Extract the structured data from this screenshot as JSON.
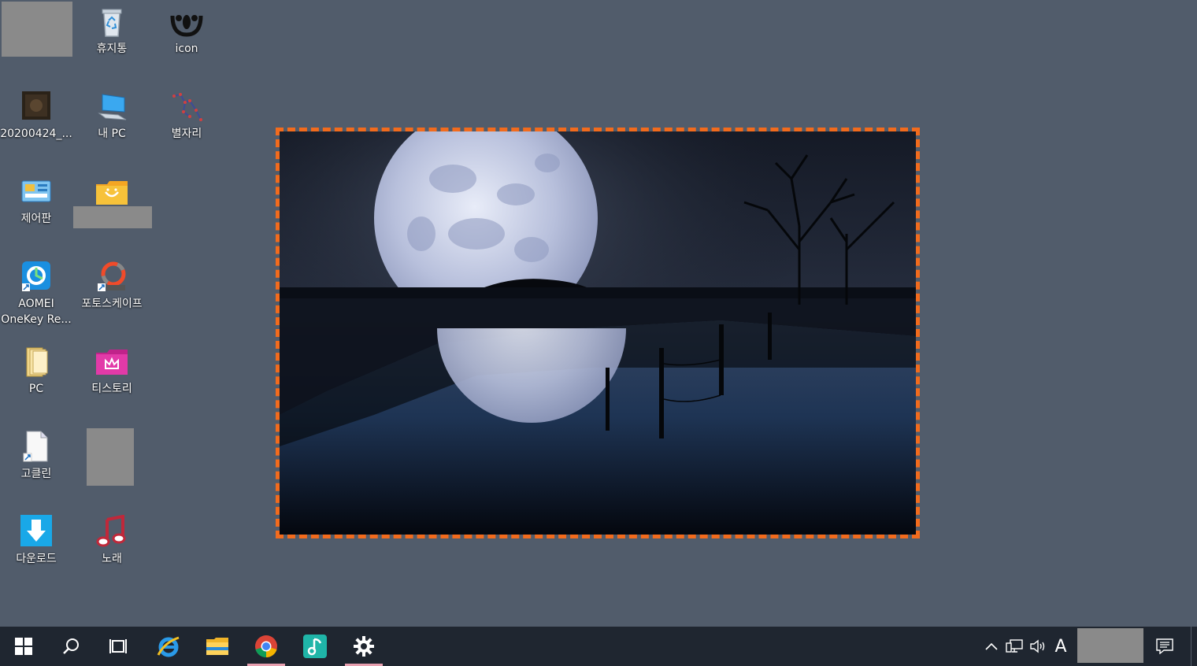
{
  "desktop": {
    "background": "#515c6b",
    "icons": [
      {
        "label": "휴지통",
        "icon": "recycle-bin-icon"
      },
      {
        "label": "icon",
        "icon": "app-icon"
      },
      {
        "label": "20200424_...",
        "icon": "image-file-icon"
      },
      {
        "label": "내 PC",
        "icon": "this-pc-icon"
      },
      {
        "label": "별자리",
        "icon": "constellation-icon"
      },
      {
        "label": "제어판",
        "icon": "control-panel-icon"
      },
      {
        "label": "AOMEI\nOneKey Re...",
        "icon": "aomei-onekey-icon"
      },
      {
        "label": "포토스케이프",
        "icon": "photoscape-icon"
      },
      {
        "label": "PC",
        "icon": "folder-icon"
      },
      {
        "label": "티스토리",
        "icon": "tistory-folder-icon"
      },
      {
        "label": "고클린",
        "icon": "goclean-shortcut-icon"
      },
      {
        "label": "다운로드",
        "icon": "download-icon"
      },
      {
        "label": "노래",
        "icon": "music-icon"
      }
    ]
  },
  "snip": {
    "border_color": "#f26b1d",
    "image": "full-moon-over-lake"
  },
  "taskbar": {
    "background": "#1f2630",
    "apps": [
      "start-icon",
      "search-icon",
      "task-view-icon",
      "internet-explorer-icon",
      "file-explorer-icon",
      "chrome-icon",
      "music-app-icon",
      "settings-icon"
    ],
    "tray": {
      "language": "A",
      "icons": [
        "show-hidden-icons-icon",
        "network-icon",
        "volume-icon",
        "notification-icon"
      ]
    }
  }
}
